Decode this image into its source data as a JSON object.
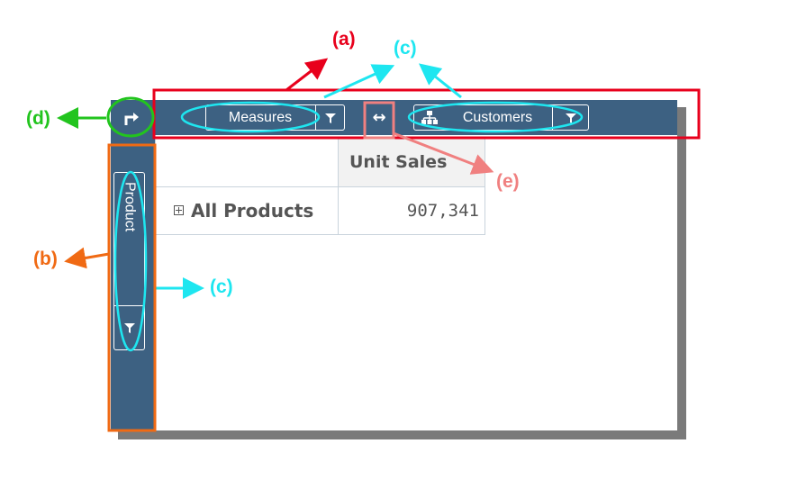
{
  "toolbar": {
    "chips": [
      {
        "label": "Measures",
        "icon": "filter-icon"
      },
      {
        "label": "Customers",
        "icon": "hierarchy-icon",
        "filter_icon": "filter-icon"
      }
    ],
    "swap_icon": "swap-axes-icon",
    "swap_glyph": "↔"
  },
  "sidebar": {
    "corner_icon": "pivot-icon",
    "chips": [
      {
        "label": "Product",
        "icon": "filter-icon"
      }
    ]
  },
  "grid": {
    "column_header": "Unit Sales",
    "rows": [
      {
        "label": "All Products",
        "value": "907,341"
      }
    ]
  },
  "annotations": {
    "a": "(a)",
    "b": "(b)",
    "c": "(c)",
    "d": "(d)",
    "e": "(e)"
  },
  "colors": {
    "bar": "#3d6182",
    "red": "#e8001c",
    "cyan": "#1ee6f0",
    "green": "#22c41e",
    "orange": "#f06a14",
    "salmon": "#f08080"
  }
}
